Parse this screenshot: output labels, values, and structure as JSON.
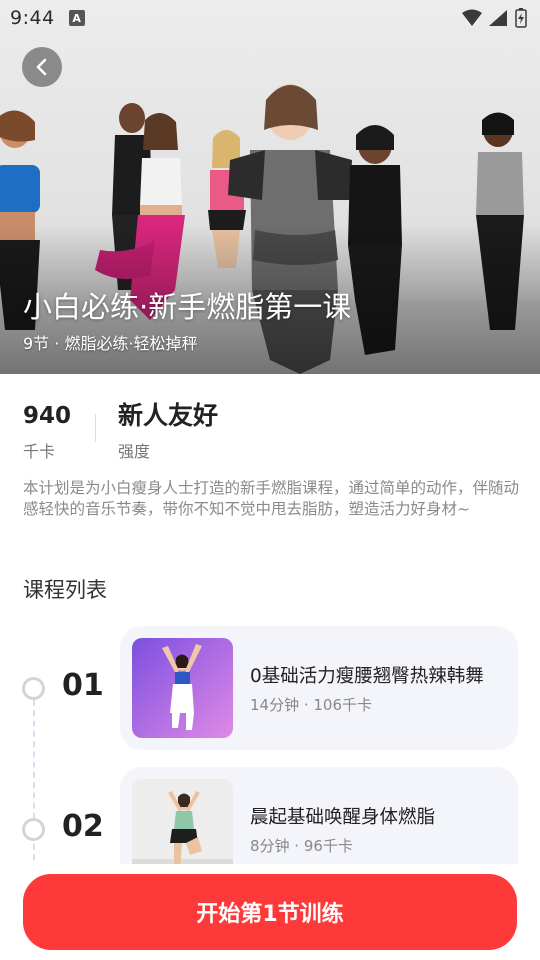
{
  "status_bar": {
    "time": "9:44",
    "notification_letter": "A"
  },
  "hero": {
    "title": "小白必练·新手燃脂第一课",
    "subtitle": "9节 · 燃脂必练·轻松掉秤"
  },
  "stats": {
    "calories_value": "940",
    "calories_label": "千卡",
    "intensity_value": "新人友好",
    "intensity_label": "强度"
  },
  "description": "本计划是为小白瘦身人士打造的新手燃脂课程，通过简单的动作，伴随动感轻快的音乐节奏，带你不知不觉中甩去脂肪，塑造活力好身材~",
  "section_title": "课程列表",
  "lessons": [
    {
      "number": "01",
      "name": "0基础活力瘦腰翘臀热辣韩舞",
      "meta": "14分钟 · 106千卡"
    },
    {
      "number": "02",
      "name": "晨起基础唤醒身体燃脂",
      "meta": "8分钟 · 96千卡"
    }
  ],
  "start_button": "开始第1节训练",
  "colors": {
    "accent": "#fd3a39",
    "card": "#f4f5fa"
  }
}
